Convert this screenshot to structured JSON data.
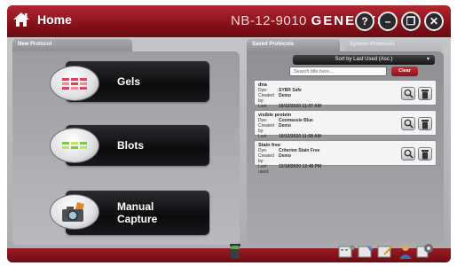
{
  "header": {
    "home_label": "Home",
    "device_prefix": "NB-12-9010 ",
    "device_brand": "GENESYS",
    "buttons": [
      {
        "name": "help-button",
        "glyph": "?"
      },
      {
        "name": "minimize-button",
        "glyph": "–"
      },
      {
        "name": "restore-button",
        "glyph": "❐"
      },
      {
        "name": "close-button",
        "glyph": "✕"
      }
    ]
  },
  "tabs": {
    "new_protocol": "New Protocol",
    "saved_protocols": "Saved Protocols",
    "system_protocols": "System Protocols"
  },
  "left": {
    "gels": "Gels",
    "blots": "Blots",
    "capture_line1": "Manual",
    "capture_line2": "Capture"
  },
  "saved": {
    "sort_label": "Sort by Last Used (Asc.)",
    "search_placeholder": "Search title here...",
    "clear": "Clear",
    "field_labels": {
      "dye": "Dye:",
      "created_by": "Created by:",
      "last_used": "Last used:"
    },
    "protocols": [
      {
        "title": "dna",
        "dye": "SYBR Safe",
        "created_by": "Demo",
        "last_used": "10/12/2020 11:07 AM"
      },
      {
        "title": "visible protein",
        "dye": "Coomassie Blue",
        "created_by": "Demo",
        "last_used": "10/12/2020 11:08 AM"
      },
      {
        "title": "Stain free",
        "dye": "Criterion Stain Free",
        "created_by": "Demo",
        "last_used": "12/18/2020 12:48 PM"
      }
    ]
  },
  "colors": {
    "header_red": "#8e1119",
    "clear_red": "#c62f39",
    "panel_gray": "#a8a9ad"
  },
  "icons": [
    "home-icon",
    "gel-icon",
    "blot-icon",
    "camera-icon",
    "magnifier-icon",
    "trash-icon",
    "recycle-bin-icon",
    "settings-icon",
    "user-icon"
  ]
}
